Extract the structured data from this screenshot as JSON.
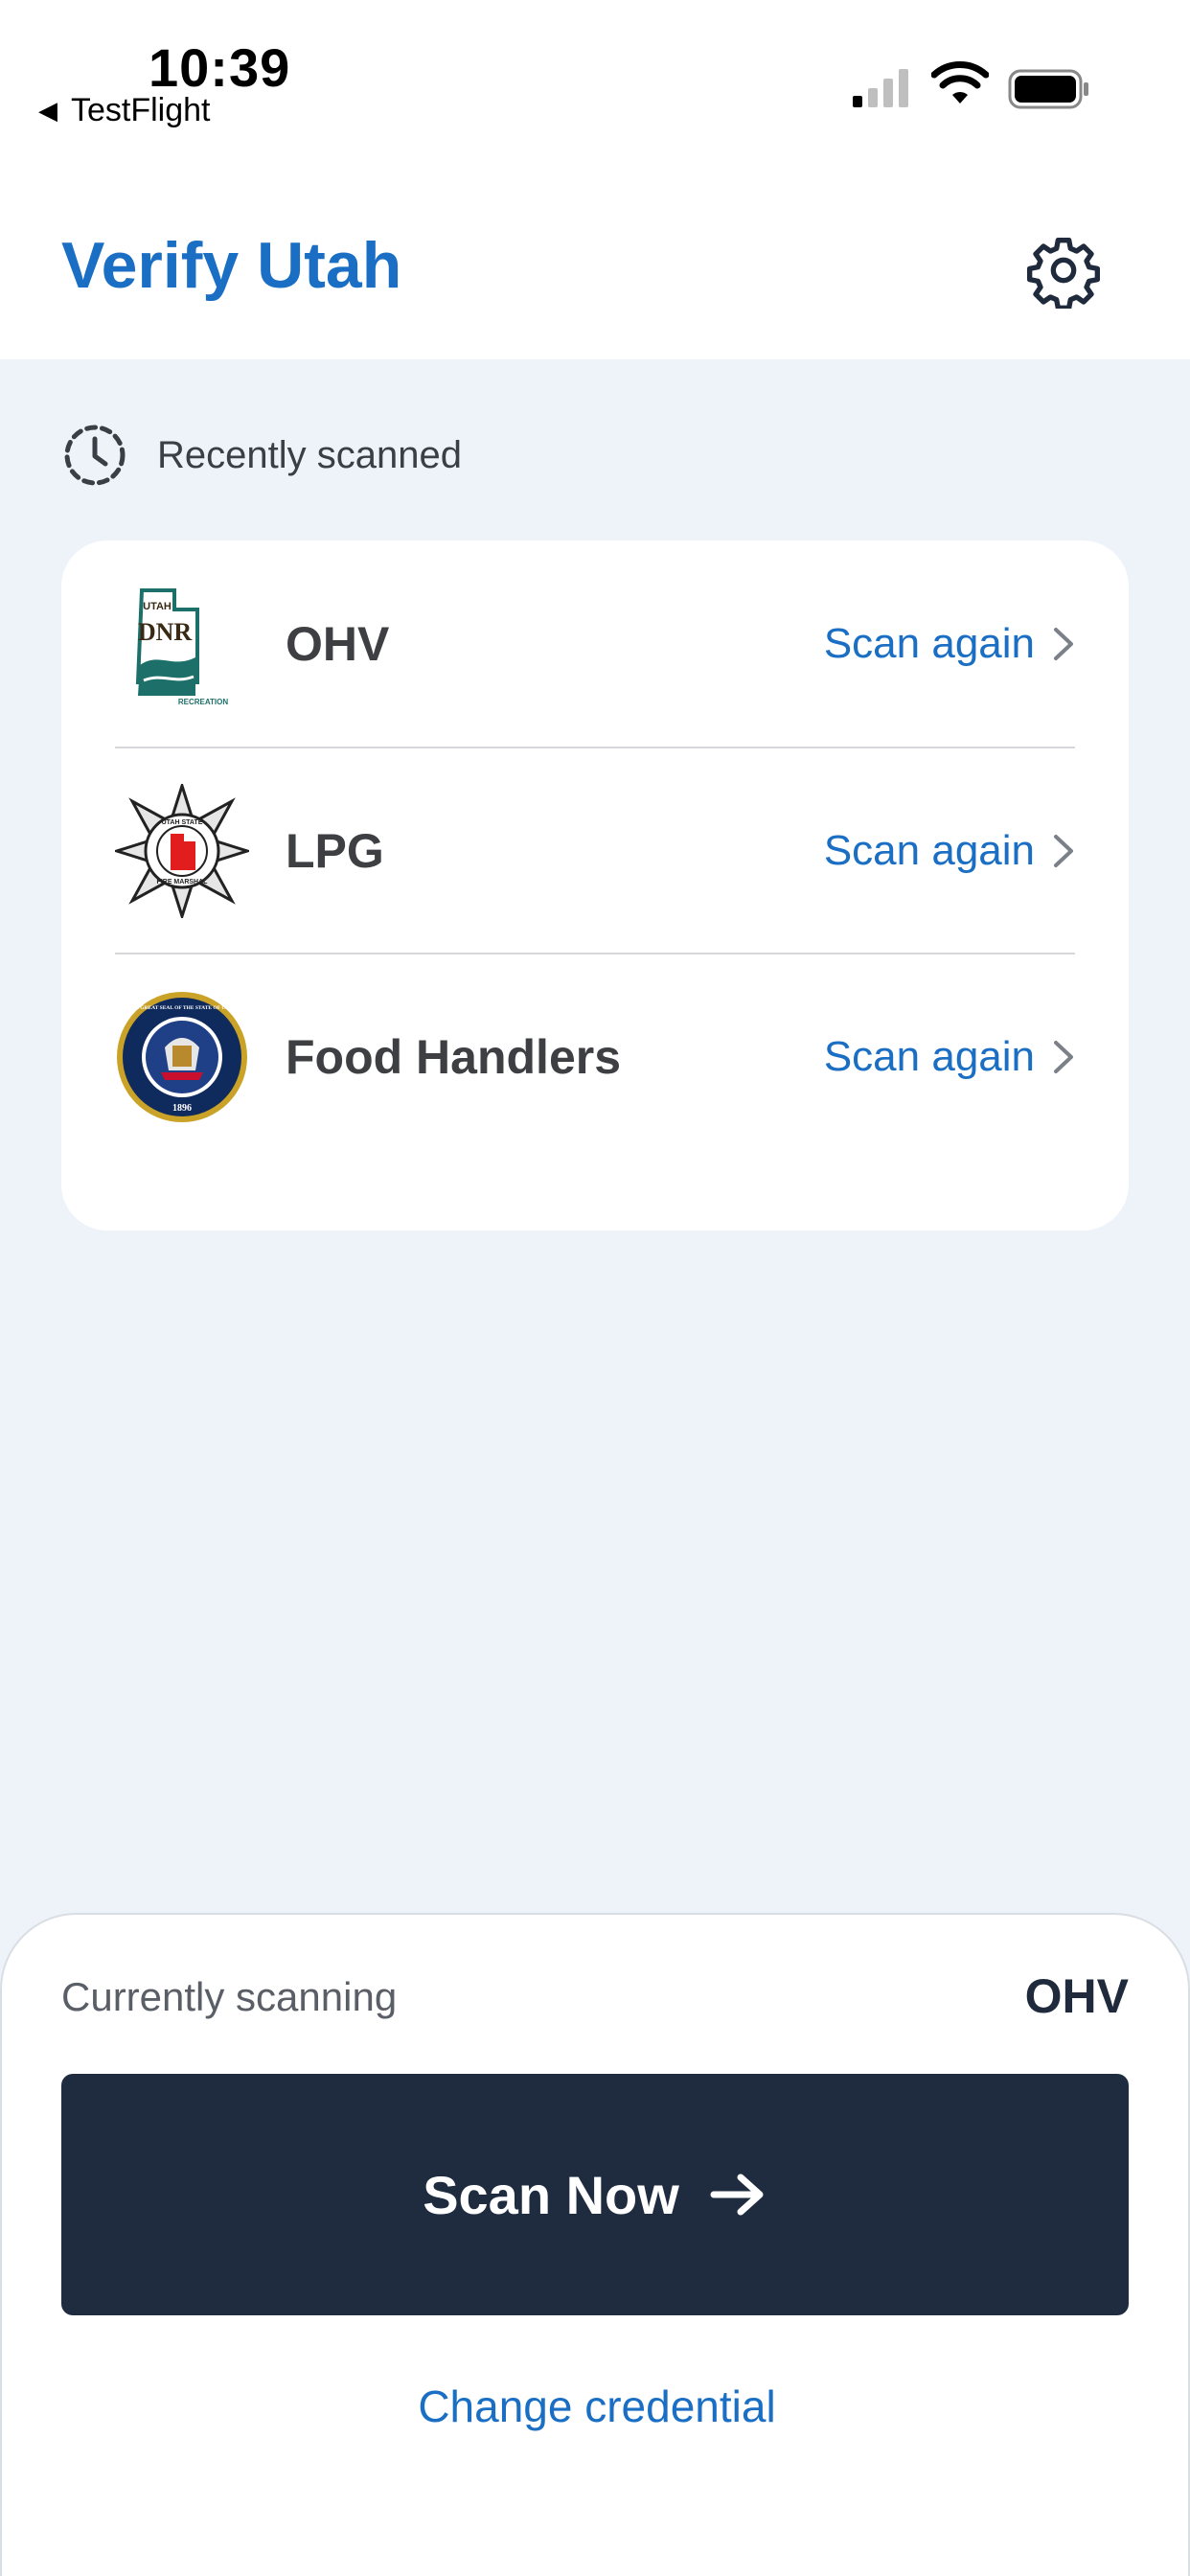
{
  "status_bar": {
    "time": "10:39",
    "back_app": "TestFlight"
  },
  "header": {
    "title": "Verify Utah",
    "settings_icon": "gear-icon"
  },
  "recent": {
    "label": "Recently scanned",
    "icon": "clock-history-icon",
    "items": [
      {
        "name": "OHV",
        "action": "Scan again",
        "logo": "utah-dnr-recreation-logo",
        "logo_text_top": "UTAH",
        "logo_text_mid": "DNR",
        "logo_text_bottom": "RECREATION"
      },
      {
        "name": "LPG",
        "action": "Scan again",
        "logo": "utah-state-fire-marshal-badge",
        "logo_text_top": "UTAH STATE",
        "logo_text_bottom": "FIRE MARSHAL"
      },
      {
        "name": "Food Handlers",
        "action": "Scan again",
        "logo": "great-seal-of-utah",
        "logo_text_ring": "THE GREAT SEAL OF THE STATE OF UTAH",
        "logo_text_year": "1896"
      }
    ]
  },
  "bottom_sheet": {
    "current_label": "Currently scanning",
    "current_value": "OHV",
    "scan_button": "Scan Now",
    "change_link": "Change credential"
  },
  "colors": {
    "accent": "#1a6fc4",
    "button_bg": "#1f2c40",
    "page_bg": "#eef2f9"
  }
}
